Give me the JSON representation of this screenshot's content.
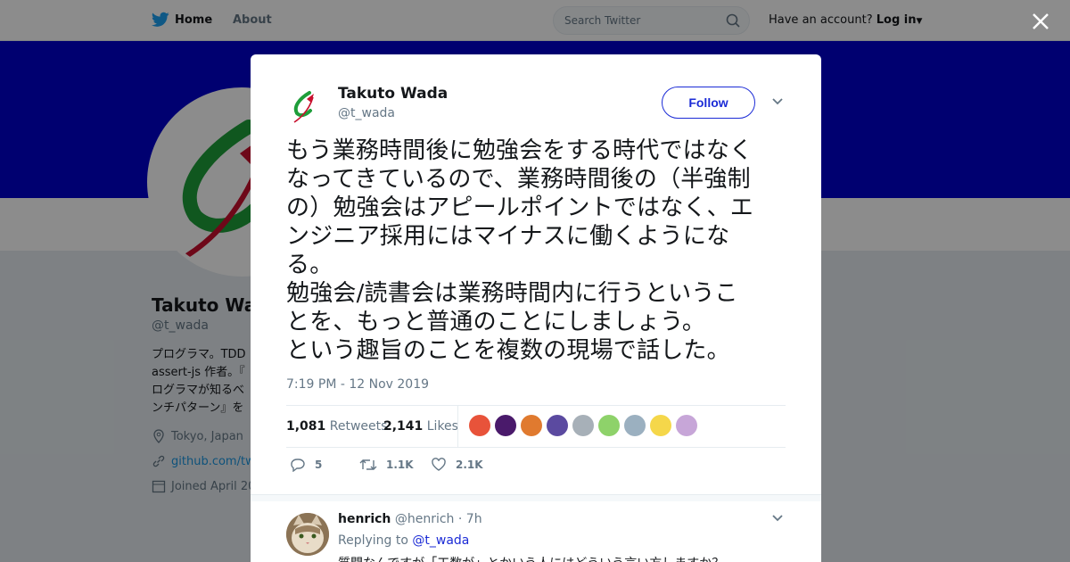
{
  "nav": {
    "home": "Home",
    "about": "About",
    "search_placeholder": "Search Twitter",
    "account_prompt": "Have an account?",
    "login": "Log in"
  },
  "profile": {
    "name": "Takuto Wada",
    "handle": "@t_wada",
    "bio": "プログラマ。TDD\nassert-js 作者。『\nログラマが知るべ\nンチパターン』を",
    "location": "Tokyo, Japan",
    "website": "github.com/twa",
    "joined": "Joined April 20"
  },
  "tweet": {
    "author_name": "Takuto Wada",
    "author_handle": "@t_wada",
    "follow_label": "Follow",
    "text": "もう業務時間後に勉強会をする時代ではなく\nなってきているので、業務時間後の（半強制\nの）勉強会はアピールポイントではなく、エ\nンジニア採用にはマイナスに働くようにな\nる。\n勉強会/読書会は業務時間内に行うというこ\nとを、もっと普通のことにしましょう。\nという趣旨のことを複数の現場で話した。",
    "timestamp": "7:19 PM - 12 Nov 2019",
    "retweets_count": "1,081",
    "retweets_label": "Retweets",
    "likes_count": "2,141",
    "likes_label": "Likes",
    "replies_action": "5",
    "retweets_action": "1.1K",
    "likes_action": "2.1K",
    "liker_colors": [
      "#e8533a",
      "#4a1a6b",
      "#e07a2f",
      "#5b4aa0",
      "#a7b0b8",
      "#8ed26a",
      "#9bb0c0",
      "#f5d74a",
      "#c7a6d8"
    ]
  },
  "reply": {
    "name": "henrich",
    "handle": "@henrich",
    "time": "· 7h",
    "replying_to_label": "Replying to",
    "replying_to_handle": "@t_wada",
    "text": "質問なんですが「工数が」とかいう人にはどういう言い方しますか？"
  },
  "colors": {
    "banner": "#0000cc",
    "accent": "#1b2bd6",
    "twitter_blue": "#1da1f2"
  }
}
